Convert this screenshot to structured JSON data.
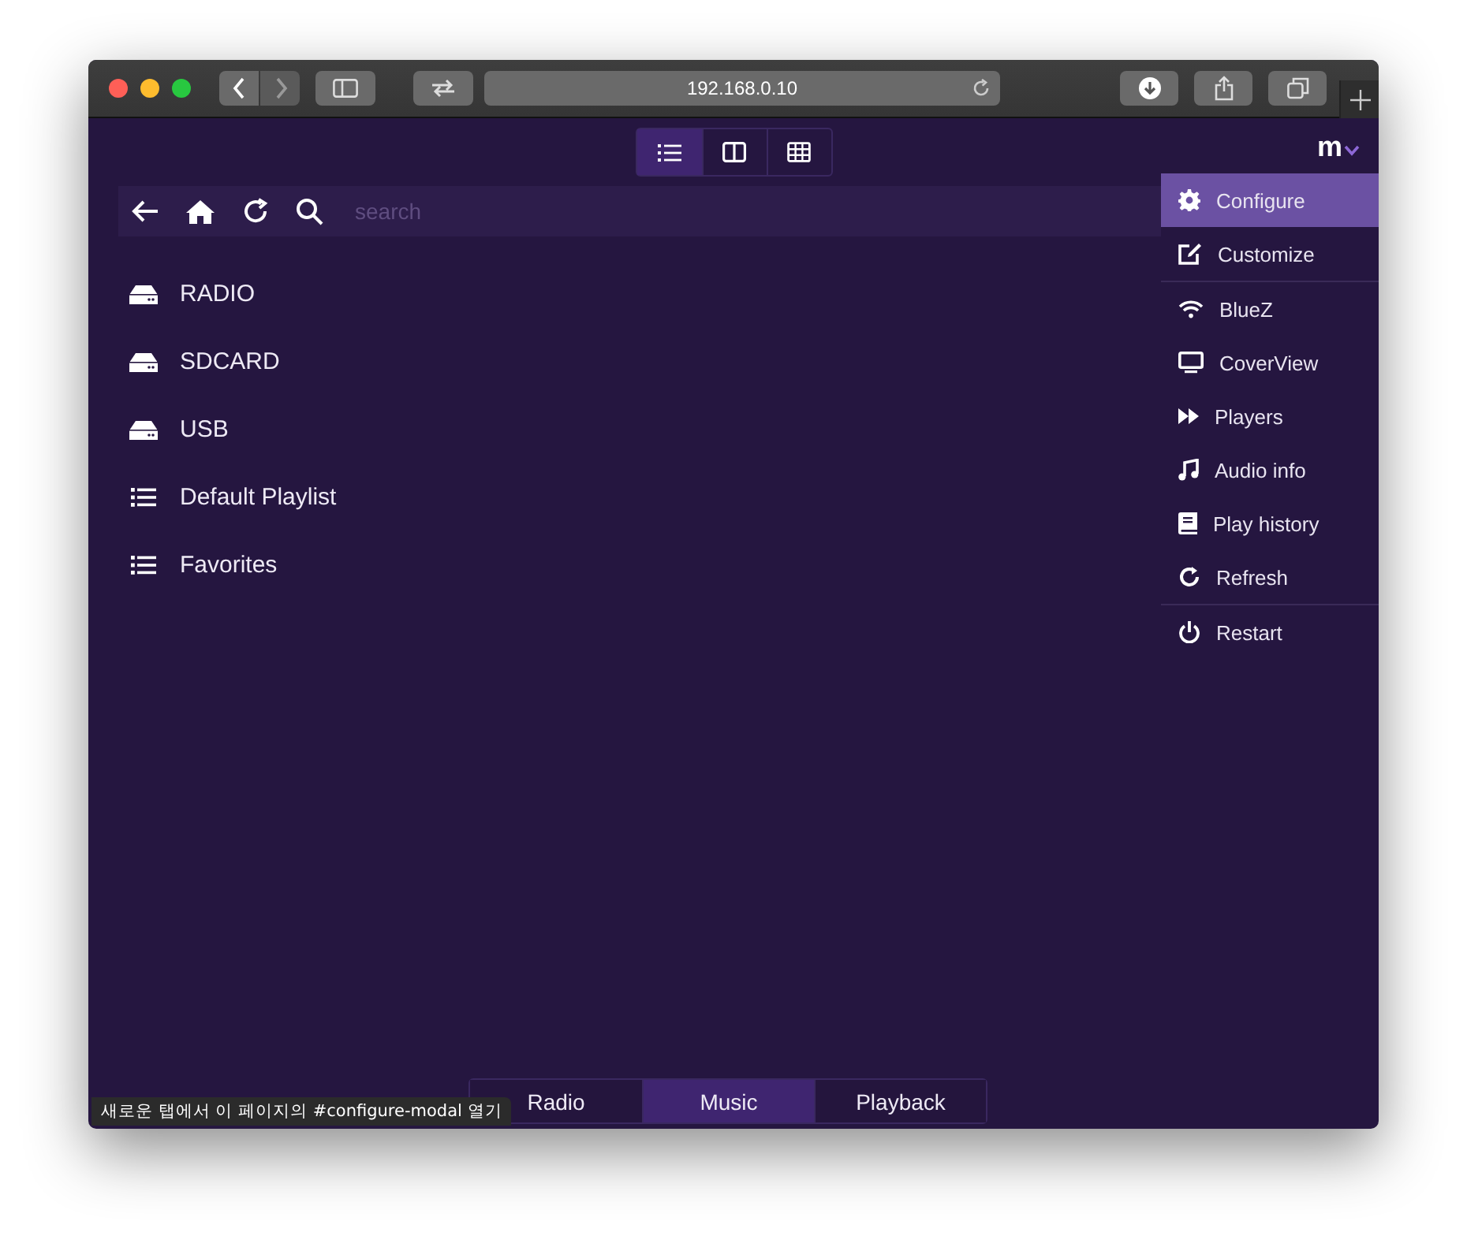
{
  "browser": {
    "url": "192.168.0.10"
  },
  "view_modes": [
    {
      "kind": "list",
      "selected": true
    },
    {
      "kind": "columns",
      "selected": false
    },
    {
      "kind": "grid",
      "selected": false
    }
  ],
  "menu_button": {
    "label": "m"
  },
  "toolbar": {
    "search": {
      "placeholder": "search"
    }
  },
  "browse_items": [
    {
      "label": "RADIO",
      "kind": "drive"
    },
    {
      "label": "SDCARD",
      "kind": "drive"
    },
    {
      "label": "USB",
      "kind": "drive"
    },
    {
      "label": "Default Playlist",
      "kind": "playlist"
    },
    {
      "label": "Favorites",
      "kind": "playlist"
    }
  ],
  "menu": {
    "items": [
      {
        "label": "Configure",
        "kind": "gear",
        "selected": true,
        "separator_before": false
      },
      {
        "label": "Customize",
        "kind": "edit",
        "selected": false,
        "separator_before": false
      },
      {
        "label": "BlueZ",
        "kind": "wifi",
        "selected": false,
        "separator_before": true
      },
      {
        "label": "CoverView",
        "kind": "monitor",
        "selected": false,
        "separator_before": false
      },
      {
        "label": "Players",
        "kind": "forward",
        "selected": false,
        "separator_before": false
      },
      {
        "label": "Audio info",
        "kind": "music",
        "selected": false,
        "separator_before": false
      },
      {
        "label": "Play history",
        "kind": "book",
        "selected": false,
        "separator_before": false
      },
      {
        "label": "Refresh",
        "kind": "refresh",
        "selected": false,
        "separator_before": false
      },
      {
        "label": "Restart",
        "kind": "power",
        "selected": false,
        "separator_before": true
      }
    ]
  },
  "bottom_tabs": [
    {
      "label": "Radio",
      "selected": false
    },
    {
      "label": "Music",
      "selected": true
    },
    {
      "label": "Playback",
      "selected": false
    }
  ],
  "status_link": "새로운 탭에서 이 페이지의 #configure-modal 열기"
}
